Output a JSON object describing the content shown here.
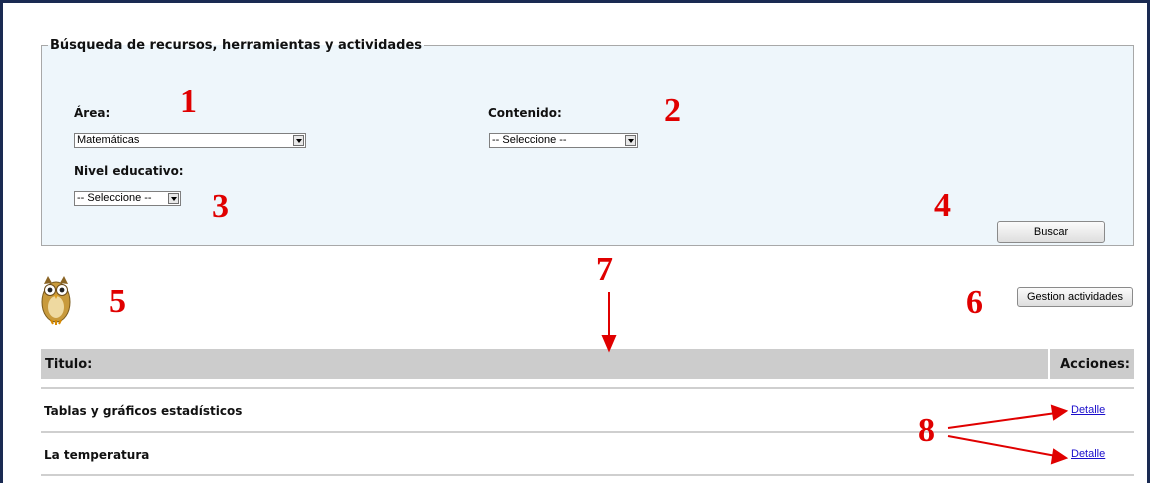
{
  "search": {
    "legend": "Búsqueda de recursos, herramientas y actividades",
    "area": {
      "label": "Área:",
      "value": "Matemáticas"
    },
    "contenido": {
      "label": "Contenido:",
      "value": "-- Seleccione --"
    },
    "nivel": {
      "label": "Nivel educativo:",
      "value": "-- Seleccione --"
    },
    "buscar_button": "Buscar"
  },
  "toolbar": {
    "gestion_button": "Gestion actividades",
    "owl_icon": "owl-mascot-icon"
  },
  "table": {
    "headers": {
      "title": "Titulo:",
      "actions": "Acciones:"
    },
    "rows": [
      {
        "title": "Tablas y gráficos estadísticos",
        "action": "Detalle"
      },
      {
        "title": "La temperatura",
        "action": "Detalle"
      }
    ]
  },
  "annotations": {
    "color": "#e00000",
    "markers": [
      "1",
      "2",
      "3",
      "4",
      "5",
      "6",
      "7",
      "8"
    ]
  }
}
